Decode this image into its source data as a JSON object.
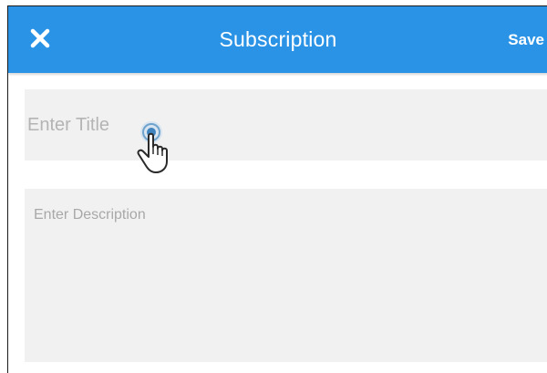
{
  "header": {
    "title": "Subscription",
    "close_icon": "close-icon",
    "save_label": "Save",
    "background_color": "#2b93e6",
    "text_color": "#ffffff"
  },
  "form": {
    "title_field": {
      "placeholder": "Enter Title",
      "value": ""
    },
    "description_field": {
      "placeholder": "Enter Description",
      "value": ""
    },
    "field_background": "#f1f1f1"
  },
  "overlay": {
    "cursor_icon": "hand-pointer-tap-icon"
  }
}
